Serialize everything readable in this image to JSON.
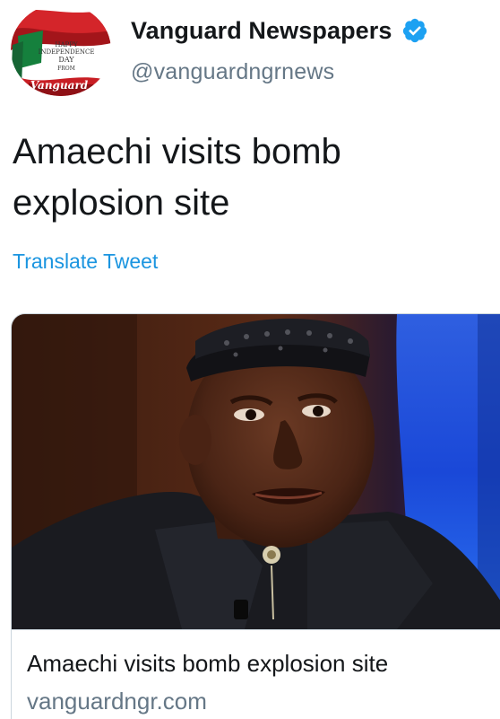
{
  "author": {
    "display_name": "Vanguard Newspapers",
    "handle": "@vanguardngrnews",
    "verified": true,
    "verified_icon": "verified-badge-icon",
    "avatar_text": [
      "HAPPY",
      "INDEPENDENCE",
      "DAY",
      "FROM",
      "Vanguard"
    ]
  },
  "tweet": {
    "text": "Amaechi visits bomb explosion site",
    "translate_label": "Translate Tweet"
  },
  "card": {
    "image_description": "Man wearing a black patterned cap and dark outfit",
    "title": "Amaechi visits bomb explosion site",
    "domain": "vanguardngr.com"
  },
  "colors": {
    "link": "#1b95e0",
    "verified": "#1da1f2",
    "secondary_text": "#657786",
    "primary_text": "#14171a",
    "border": "#ccd6dd"
  }
}
